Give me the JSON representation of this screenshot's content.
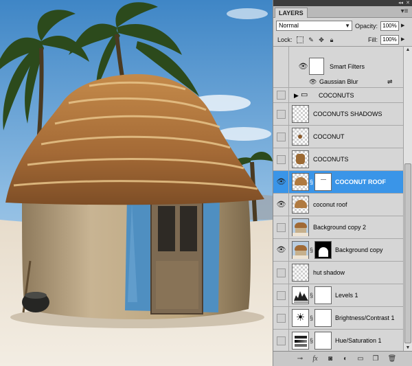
{
  "panel": {
    "tab_label": "LAYERS",
    "blend_mode": "Normal",
    "opacity_label": "Opacity:",
    "opacity_value": "100%",
    "lock_label": "Lock:",
    "fill_label": "Fill:",
    "fill_value": "100%"
  },
  "layers": {
    "smart_filters": "Smart Filters",
    "gaussian_blur": "Gaussian Blur",
    "coconuts_group": "COCONUTS",
    "coconuts_shadows": "COCONUTS SHADOWS",
    "coconut": "COCONUT",
    "coconuts": "COCONUTS",
    "coconut_roof_upper": "COCONUT ROOF",
    "coconut_roof": "coconut roof",
    "background_copy_2": "Background copy 2",
    "background_copy": "Background copy",
    "hut_shadow": "hut shadow",
    "levels_1": "Levels 1",
    "brightness_contrast_1": "Brightness/Contrast 1",
    "hue_saturation_1": "Hue/Saturation 1"
  },
  "colors": {
    "selection": "#3a95e8",
    "panel_bg": "#d6d6d6"
  }
}
